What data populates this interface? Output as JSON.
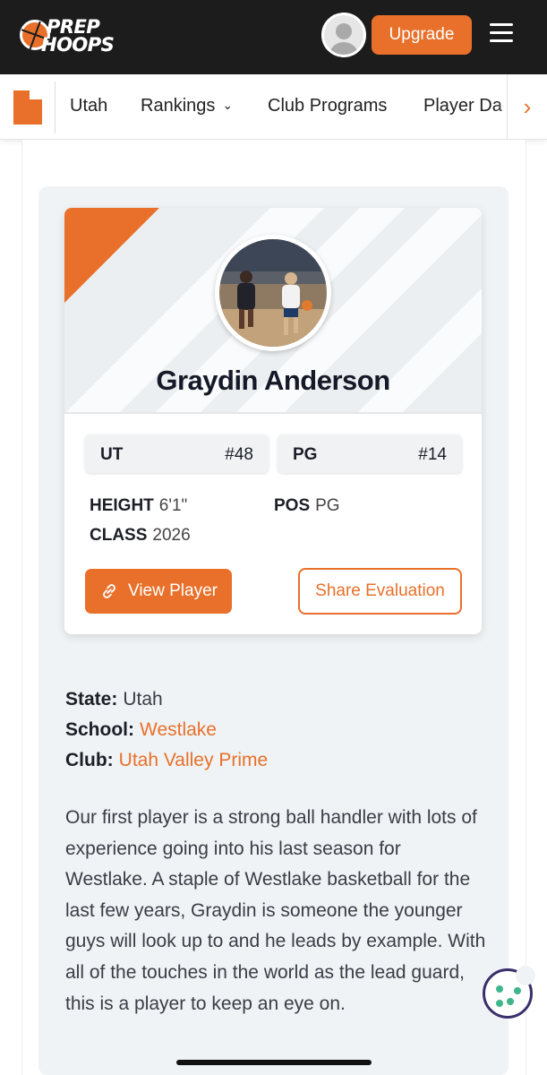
{
  "header": {
    "logo_line1": "PREP",
    "logo_line2": "HOOPS",
    "upgrade_label": "Upgrade"
  },
  "subnav": {
    "items": [
      {
        "label": "Utah"
      },
      {
        "label": "Rankings"
      },
      {
        "label": "Club Programs"
      },
      {
        "label": "Player Da"
      }
    ],
    "next_arrow": "›"
  },
  "player": {
    "name": "Graydin Anderson",
    "state_rank_label": "UT",
    "state_rank_value": "#48",
    "position_rank_label": "PG",
    "position_rank_value": "#14",
    "height_label": "HEIGHT",
    "height_value": "6'1\"",
    "class_label": "CLASS",
    "class_value": "2026",
    "pos_label": "POS",
    "pos_value": "PG",
    "view_button": "View Player",
    "share_button": "Share Evaluation"
  },
  "info": {
    "state_label": "State:",
    "state_value": "Utah",
    "school_label": "School:",
    "school_value": "Westlake",
    "club_label": "Club:",
    "club_value": "Utah Valley Prime"
  },
  "description": "Our first player is a strong ball handler with lots of experience going into his last season for Westlake. A staple of Westlake basketball for the last few years, Graydin is someone the younger guys will look up to and he leads by example. With all of the touches in the world as the lead guard, this is a player to keep an eye on.",
  "colors": {
    "accent": "#e8702a",
    "header_bg": "#1c1c1c",
    "cookie_border": "#3a2f6b",
    "cookie_chip": "#3fb58a"
  }
}
